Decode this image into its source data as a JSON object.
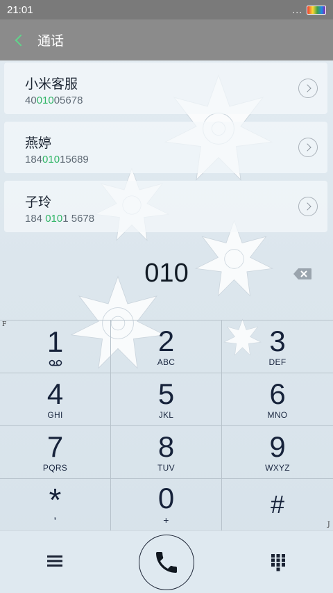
{
  "status_bar": {
    "time": "21:01",
    "dots": "..."
  },
  "header": {
    "title": "通话"
  },
  "contacts": [
    {
      "name": "小米客服",
      "number_pre": "40",
      "number_hl": "010",
      "number_post": "05678"
    },
    {
      "name": "燕婷",
      "number_pre": "184",
      "number_hl": "010",
      "number_post": "15689"
    },
    {
      "name": "子玲",
      "number_pre": "184 ",
      "number_hl": "010",
      "number_post": "1 5678"
    }
  ],
  "dialer": {
    "dialed_number": "010"
  },
  "keypad": [
    {
      "digit": "1",
      "letters": ""
    },
    {
      "digit": "2",
      "letters": "ABC"
    },
    {
      "digit": "3",
      "letters": "DEF"
    },
    {
      "digit": "4",
      "letters": "GHI"
    },
    {
      "digit": "5",
      "letters": "JKL"
    },
    {
      "digit": "6",
      "letters": "MNO"
    },
    {
      "digit": "7",
      "letters": "PQRS"
    },
    {
      "digit": "8",
      "letters": "TUV"
    },
    {
      "digit": "9",
      "letters": "WXYZ"
    },
    {
      "digit": "*",
      "letters": ","
    },
    {
      "digit": "0",
      "letters": "+"
    },
    {
      "digit": "#",
      "letters": ""
    }
  ],
  "markers": {
    "left": "F",
    "right": "J"
  },
  "icons": {
    "back": "chevron-left-icon",
    "backspace": "backspace-icon",
    "voicemail": "voicemail-icon",
    "menu": "menu-icon",
    "call": "phone-icon",
    "keypad_toggle": "dialpad-icon"
  },
  "colors": {
    "accent": "#2fb565",
    "header_bg": "#8b8b8b",
    "status_bg": "#7a7a7a"
  }
}
